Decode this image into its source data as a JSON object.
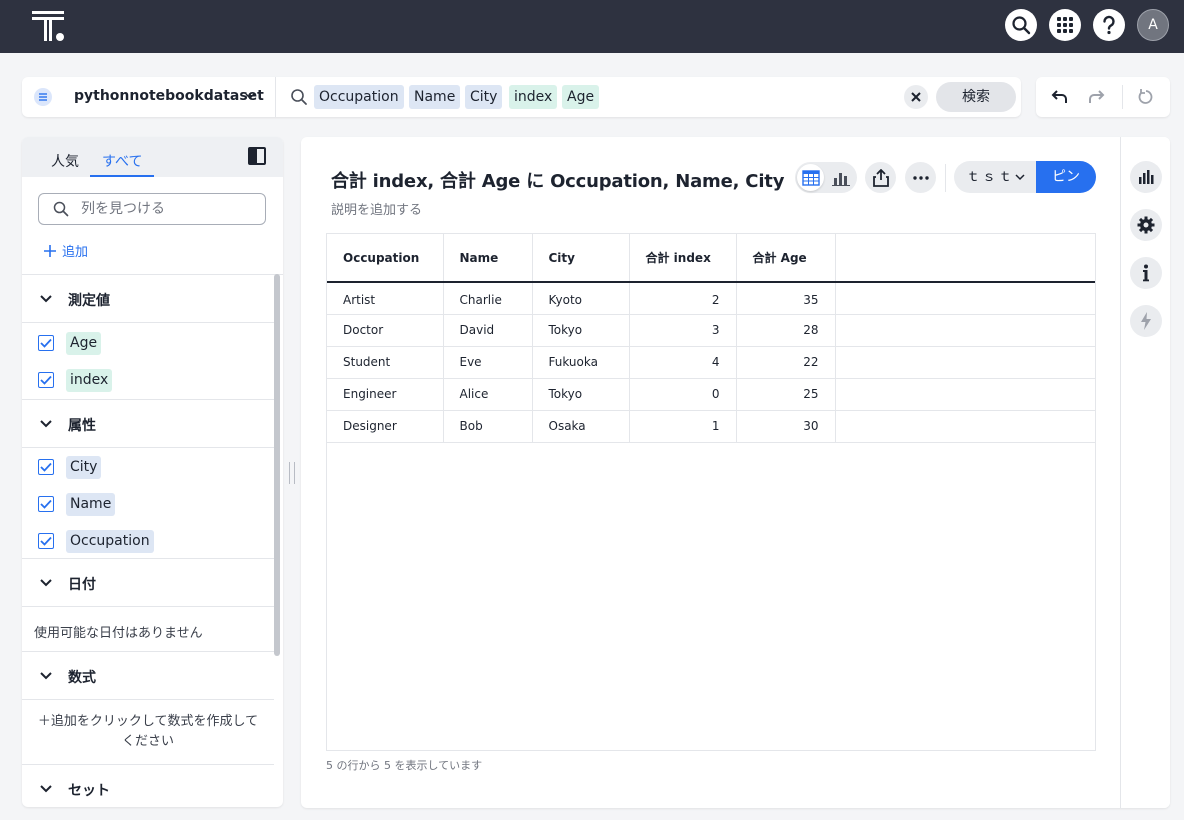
{
  "topbar": {
    "avatar_initial": "A"
  },
  "search": {
    "datasource": "pythonnotebookdataset",
    "tokens": [
      {
        "label": "Occupation",
        "kind": "attribute"
      },
      {
        "label": "Name",
        "kind": "attribute"
      },
      {
        "label": "City",
        "kind": "attribute"
      },
      {
        "label": "index",
        "kind": "measure"
      },
      {
        "label": "Age",
        "kind": "measure"
      }
    ],
    "search_button": "検索"
  },
  "left_panel": {
    "tabs": [
      "人気",
      "すべて"
    ],
    "active_tab": "すべて",
    "find_placeholder": "列を見つける",
    "add_label": "追加",
    "sections": {
      "measures": {
        "title": "測定値",
        "items": [
          {
            "label": "Age",
            "checked": true
          },
          {
            "label": "index",
            "checked": true
          }
        ]
      },
      "attributes": {
        "title": "属性",
        "items": [
          {
            "label": "City",
            "checked": true
          },
          {
            "label": "Name",
            "checked": true
          },
          {
            "label": "Occupation",
            "checked": true
          }
        ]
      },
      "dates": {
        "title": "日付",
        "empty": "使用可能な日付はありません"
      },
      "formulas": {
        "title": "数式",
        "empty": "＋追加をクリックして数式を作成してください"
      },
      "sets": {
        "title": "セット"
      }
    }
  },
  "main": {
    "title": "合計 index, 合計 Age に Occupation, Name, City",
    "description_placeholder": "説明を追加する",
    "liveboard_name": "ｔｓｔ",
    "pin_button": "ピン",
    "table": {
      "columns": [
        "Occupation",
        "Name",
        "City",
        "合計 index",
        "合計 Age"
      ],
      "rows": [
        [
          "Artist",
          "Charlie",
          "Kyoto",
          "2",
          "35"
        ],
        [
          "Doctor",
          "David",
          "Tokyo",
          "3",
          "28"
        ],
        [
          "Student",
          "Eve",
          "Fukuoka",
          "4",
          "22"
        ],
        [
          "Engineer",
          "Alice",
          "Tokyo",
          "0",
          "25"
        ],
        [
          "Designer",
          "Bob",
          "Osaka",
          "1",
          "30"
        ]
      ]
    },
    "row_count_text": "5 の行から 5 を表示しています"
  },
  "colors": {
    "topbar_bg": "#2e3240",
    "accent": "#2770ef",
    "attribute_chip": "#dde6f4",
    "measure_chip": "#d9f2ea"
  },
  "icons": {
    "topbar": [
      "search-icon",
      "apps-grid-icon",
      "help-icon"
    ],
    "rail": [
      "chart-config-icon",
      "settings-icon",
      "info-icon",
      "spotiq-bolt-icon"
    ]
  }
}
